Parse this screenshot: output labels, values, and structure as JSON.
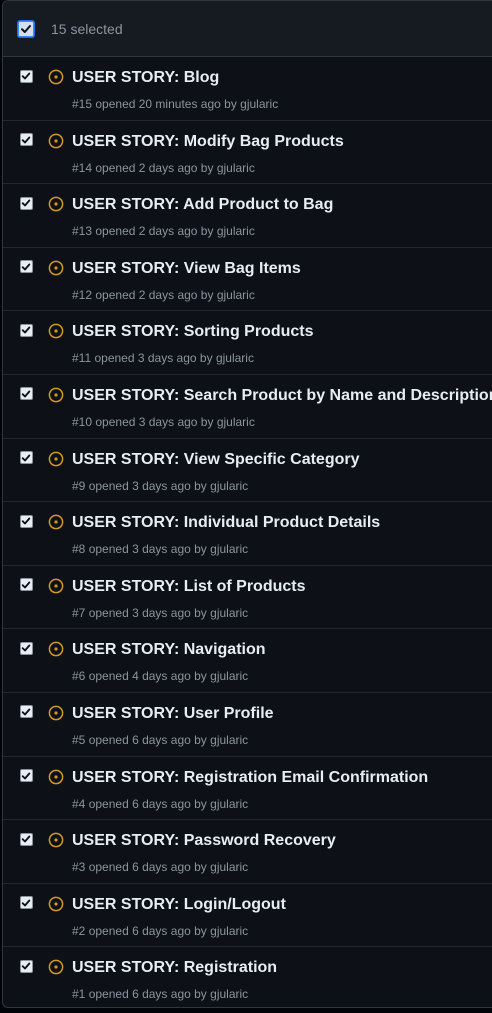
{
  "header": {
    "selected_label": "15 selected"
  },
  "colors": {
    "open_icon": "#d29922",
    "checkbox_check": "#0d1117",
    "background": "#0d1117"
  },
  "icons": {
    "issue_status": "issue-opened-icon",
    "checkbox": "checkbox-checked-icon"
  },
  "issues": [
    {
      "title": "USER STORY: Blog",
      "number": "#15",
      "opened_text": "opened 20 minutes ago by",
      "author": "gjularic",
      "checked": true
    },
    {
      "title": "USER STORY: Modify Bag Products",
      "number": "#14",
      "opened_text": "opened 2 days ago by",
      "author": "gjularic",
      "checked": true
    },
    {
      "title": "USER STORY: Add Product to Bag",
      "number": "#13",
      "opened_text": "opened 2 days ago by",
      "author": "gjularic",
      "checked": true
    },
    {
      "title": "USER STORY: View Bag Items",
      "number": "#12",
      "opened_text": "opened 2 days ago by",
      "author": "gjularic",
      "checked": true
    },
    {
      "title": "USER STORY: Sorting Products",
      "number": "#11",
      "opened_text": "opened 3 days ago by",
      "author": "gjularic",
      "checked": true
    },
    {
      "title": "USER STORY: Search Product by Name and Description",
      "number": "#10",
      "opened_text": "opened 3 days ago by",
      "author": "gjularic",
      "checked": true
    },
    {
      "title": "USER STORY: View Specific Category",
      "number": "#9",
      "opened_text": "opened 3 days ago by",
      "author": "gjularic",
      "checked": true
    },
    {
      "title": "USER STORY: Individual Product Details",
      "number": "#8",
      "opened_text": "opened 3 days ago by",
      "author": "gjularic",
      "checked": true
    },
    {
      "title": "USER STORY: List of Products",
      "number": "#7",
      "opened_text": "opened 3 days ago by",
      "author": "gjularic",
      "checked": true
    },
    {
      "title": "USER STORY: Navigation",
      "number": "#6",
      "opened_text": "opened 4 days ago by",
      "author": "gjularic",
      "checked": true
    },
    {
      "title": "USER STORY: User Profile",
      "number": "#5",
      "opened_text": "opened 6 days ago by",
      "author": "gjularic",
      "checked": true
    },
    {
      "title": "USER STORY: Registration Email Confirmation",
      "number": "#4",
      "opened_text": "opened 6 days ago by",
      "author": "gjularic",
      "checked": true
    },
    {
      "title": "USER STORY: Password Recovery",
      "number": "#3",
      "opened_text": "opened 6 days ago by",
      "author": "gjularic",
      "checked": true
    },
    {
      "title": "USER STORY: Login/Logout",
      "number": "#2",
      "opened_text": "opened 6 days ago by",
      "author": "gjularic",
      "checked": true
    },
    {
      "title": "USER STORY: Registration",
      "number": "#1",
      "opened_text": "opened 6 days ago by",
      "author": "gjularic",
      "checked": true
    }
  ]
}
